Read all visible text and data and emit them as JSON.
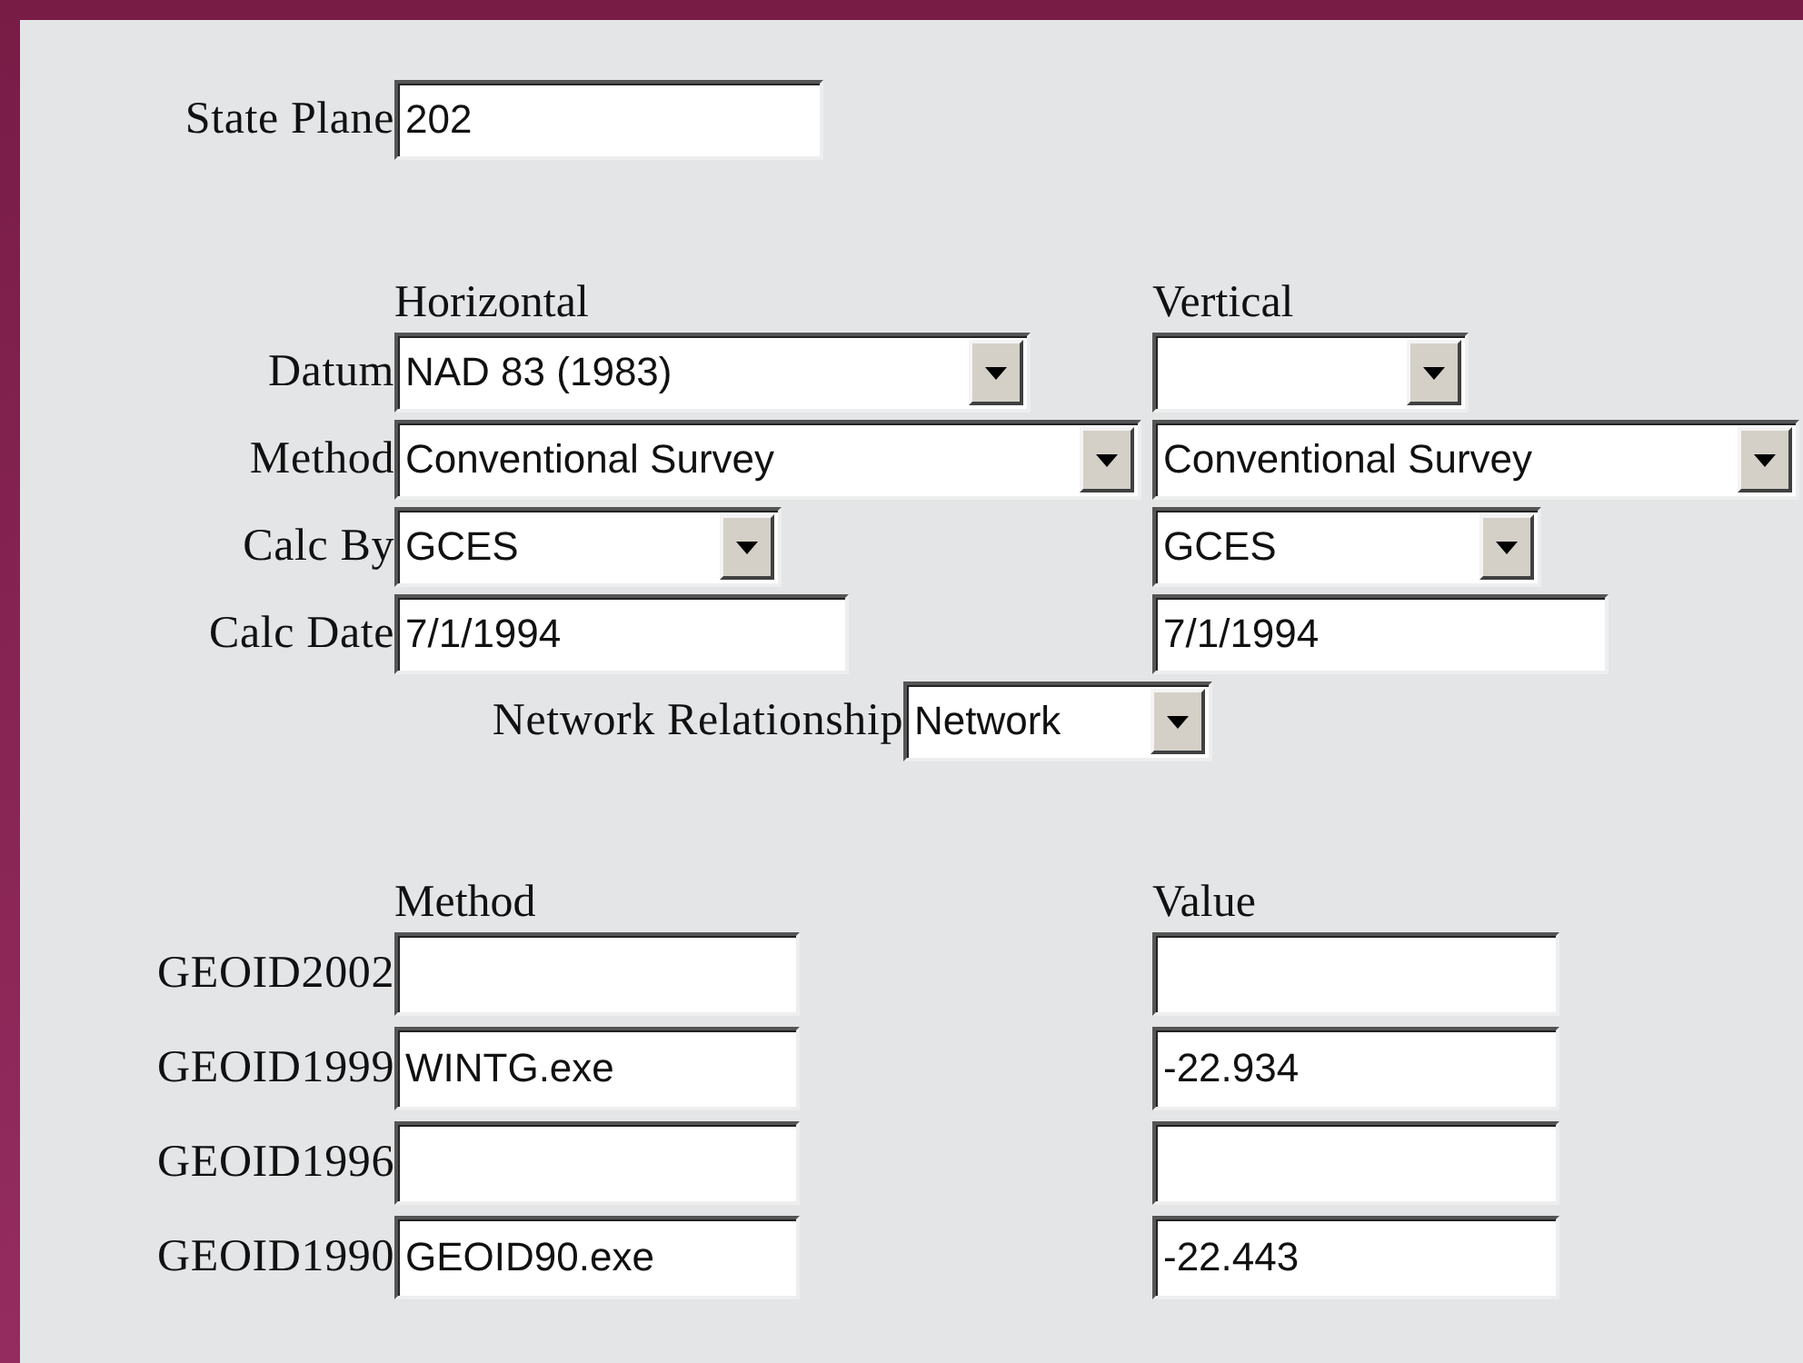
{
  "state_plane": {
    "label": "State Plane",
    "value": "202"
  },
  "datum_section": {
    "column_headers": [
      "Horizontal",
      "Vertical"
    ],
    "rows": [
      {
        "label": "Datum",
        "horizontal": {
          "kind": "select",
          "value": "NAD 83 (1983)"
        },
        "vertical": {
          "kind": "select"
        }
      },
      {
        "label": "Method",
        "horizontal": {
          "kind": "select",
          "value": "Conventional Survey"
        },
        "vertical": {
          "kind": "select",
          "value": "Conventional Survey"
        }
      },
      {
        "label": "Calc By",
        "horizontal": {
          "kind": "select",
          "value": "GCES"
        },
        "vertical": {
          "kind": "select",
          "value": "GCES"
        }
      },
      {
        "label": "Calc Date",
        "horizontal": {
          "kind": "text",
          "value": "7/1/1994"
        },
        "vertical": {
          "kind": "text",
          "value": "7/1/1994"
        }
      }
    ]
  },
  "network_relationship": {
    "label": "Network Relationship",
    "value": "Network"
  },
  "geoid_section": {
    "column_headers": [
      "Method",
      "Value"
    ],
    "rows": [
      {
        "label": "GEOID2002"
      },
      {
        "label": "GEOID1999",
        "method": "WINTG.exe",
        "value": "-22.934"
      },
      {
        "label": "GEOID1996"
      },
      {
        "label": "GEOID1990",
        "method": "GEOID90.exe",
        "value": "-22.443"
      }
    ]
  }
}
